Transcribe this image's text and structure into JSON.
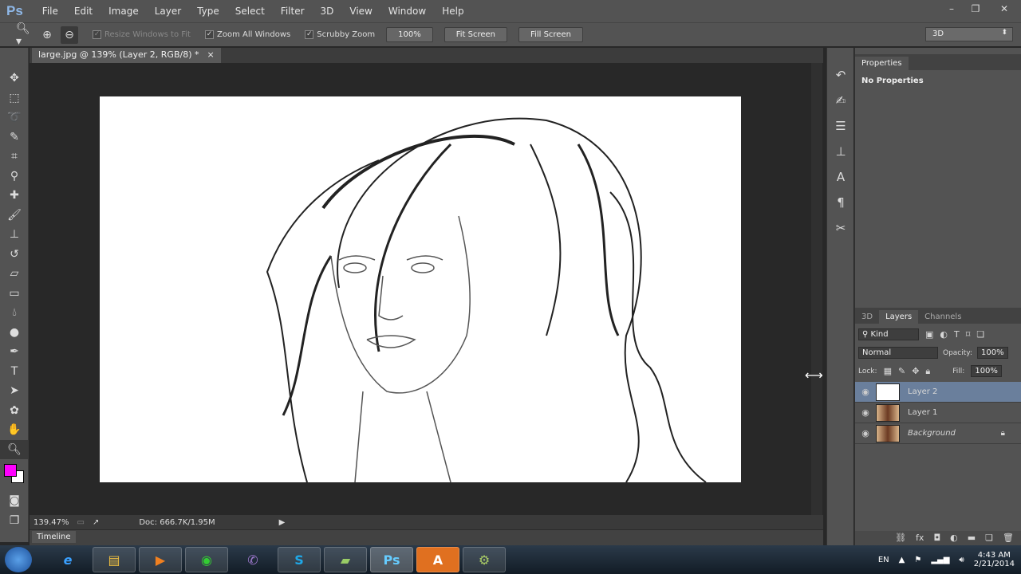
{
  "app": {
    "logo": "Ps"
  },
  "menu": [
    "File",
    "Edit",
    "Image",
    "Layer",
    "Type",
    "Select",
    "Filter",
    "3D",
    "View",
    "Window",
    "Help"
  ],
  "window_controls": {
    "minimize": "–",
    "restore": "❐",
    "close": "✕"
  },
  "options": {
    "resize_windows": "Resize Windows to Fit",
    "resize_checked": true,
    "zoom_all": "Zoom All Windows",
    "zoom_all_checked": true,
    "scrubby": "Scrubby Zoom",
    "scrubby_checked": true,
    "btn_100": "100%",
    "fit": "Fit Screen",
    "fill": "Fill Screen"
  },
  "workspace": "3D",
  "document": {
    "tab": "large.jpg @ 139% (Layer 2, RGB/8) *",
    "close": "×"
  },
  "status": {
    "zoom": "139.47%",
    "doc": "Doc: 666.7K/1.95M",
    "arrow": "▶"
  },
  "timeline": "Timeline",
  "properties": {
    "tab": "Properties",
    "content": "No Properties"
  },
  "layers_panel": {
    "tabs": [
      "3D",
      "Layers",
      "Channels"
    ],
    "active_tab": "Layers",
    "filter": "Kind",
    "blend": "Normal",
    "opacity_label": "Opacity:",
    "opacity": "100%",
    "lock_label": "Lock:",
    "fill_label": "Fill:",
    "fill": "100%",
    "layers": [
      {
        "name": "Layer 2",
        "selected": true,
        "visible": true
      },
      {
        "name": "Layer 1",
        "selected": false,
        "visible": true
      },
      {
        "name": "Background",
        "selected": false,
        "visible": true,
        "locked": true
      }
    ]
  },
  "colors": {
    "foreground": "#ff00ff",
    "background": "#ffffff",
    "selection": "#6a7f9c"
  },
  "taskbar": {
    "apps": [
      "start",
      "internet-explorer",
      "file-explorer",
      "media-player",
      "chrome",
      "viber",
      "skype",
      "notes",
      "photoshop",
      "adobe-acrobat",
      "app"
    ],
    "lang": "EN",
    "time": "4:43 AM",
    "date": "2/21/2014"
  }
}
